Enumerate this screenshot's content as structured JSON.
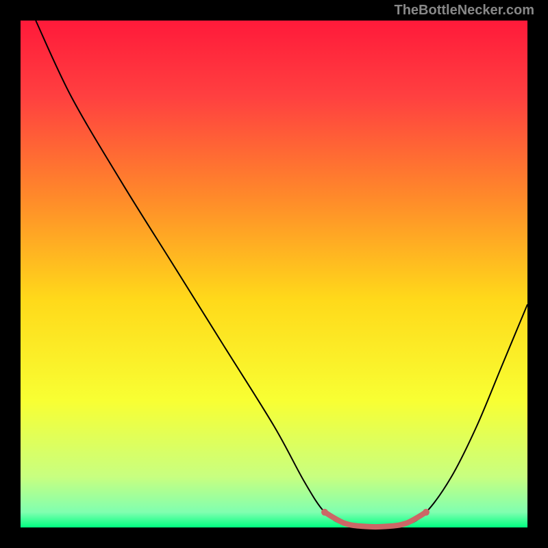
{
  "watermark": "TheBottleNecker.com",
  "chart_data": {
    "type": "line",
    "title": "",
    "xlabel": "",
    "ylabel": "",
    "xlim": [
      0,
      100
    ],
    "ylim": [
      0,
      100
    ],
    "background_gradient": {
      "stops": [
        {
          "offset": 0,
          "color": "#ff1a3a"
        },
        {
          "offset": 0.15,
          "color": "#ff4040"
        },
        {
          "offset": 0.35,
          "color": "#ff8a2a"
        },
        {
          "offset": 0.55,
          "color": "#ffd91a"
        },
        {
          "offset": 0.75,
          "color": "#f8ff33"
        },
        {
          "offset": 0.9,
          "color": "#c8ff80"
        },
        {
          "offset": 0.97,
          "color": "#80ffb0"
        },
        {
          "offset": 1.0,
          "color": "#00ff80"
        }
      ]
    },
    "curve_points": [
      {
        "x": 3,
        "y": 100
      },
      {
        "x": 10,
        "y": 85
      },
      {
        "x": 20,
        "y": 68
      },
      {
        "x": 30,
        "y": 52
      },
      {
        "x": 40,
        "y": 36
      },
      {
        "x": 50,
        "y": 20
      },
      {
        "x": 56,
        "y": 9
      },
      {
        "x": 60,
        "y": 3
      },
      {
        "x": 64,
        "y": 0.5
      },
      {
        "x": 70,
        "y": 0
      },
      {
        "x": 76,
        "y": 0.5
      },
      {
        "x": 80,
        "y": 3
      },
      {
        "x": 85,
        "y": 10
      },
      {
        "x": 90,
        "y": 20
      },
      {
        "x": 95,
        "y": 32
      },
      {
        "x": 100,
        "y": 44
      }
    ],
    "highlight_segment": {
      "color": "#cc6666",
      "points": [
        {
          "x": 60,
          "y": 3
        },
        {
          "x": 64,
          "y": 0.8
        },
        {
          "x": 68,
          "y": 0.2
        },
        {
          "x": 72,
          "y": 0.2
        },
        {
          "x": 76,
          "y": 0.8
        },
        {
          "x": 80,
          "y": 3
        }
      ]
    }
  }
}
